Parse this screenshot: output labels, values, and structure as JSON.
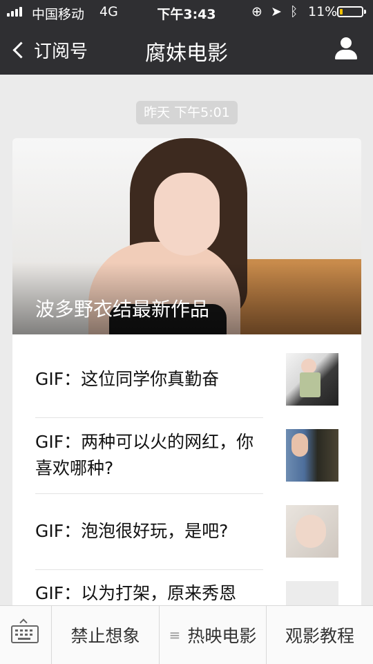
{
  "status_bar": {
    "carrier": "中国移动",
    "network": "4G",
    "time": "下午3:43",
    "battery_percent": "11%"
  },
  "nav": {
    "back_label": "订阅号",
    "title": "腐妹电影"
  },
  "timestamp": "昨天 下午5:01",
  "article": {
    "hero_title": "波多野衣结最新作品",
    "items": [
      {
        "title": "GIF：这位同学你真勤奋"
      },
      {
        "title": "GIF：两种可以火的网红，你喜欢哪种?"
      },
      {
        "title": "GIF：泡泡很好玩，是吧?"
      },
      {
        "title": "GIF：以为打架，原来秀恩"
      }
    ]
  },
  "menu": {
    "items": [
      "禁止想象",
      "热映电影",
      "观影教程"
    ],
    "submenu_indicator": "≡"
  },
  "colors": {
    "topbar": "#2f2f32",
    "battery_fill": "#f2c200"
  }
}
